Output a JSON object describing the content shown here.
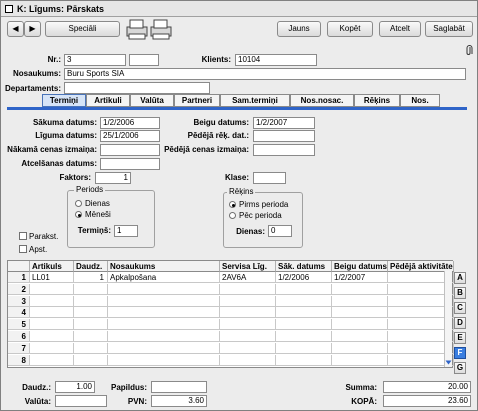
{
  "window": {
    "title": "K: Līgums: Pārskats"
  },
  "toolbar": {
    "nav_prev": "◀",
    "nav_next": "▶",
    "special": "Speciāli",
    "new": "Jauns",
    "copy": "Kopēt",
    "cancel": "Atcelt",
    "save": "Saglabāt"
  },
  "header": {
    "nr_label": "Nr.:",
    "nr_value": "3",
    "client_label": "Klients:",
    "client_value": "10104",
    "name_label": "Nosaukums:",
    "name_value": "Buru Sports SIA",
    "departments_label": "Departaments:",
    "departments_value": ""
  },
  "tabs": [
    {
      "label": "Termiņi",
      "active": true
    },
    {
      "label": "Artikuli",
      "active": false
    },
    {
      "label": "Valūta",
      "active": false
    },
    {
      "label": "Partneri",
      "active": false
    },
    {
      "label": "Sam.termiņi",
      "active": false
    },
    {
      "label": "Nos.nosac.",
      "active": false
    },
    {
      "label": "Rēķins",
      "active": false
    },
    {
      "label": "Nos.",
      "active": false
    }
  ],
  "terms": {
    "start_label": "Sākuma datums:",
    "start_value": "1/2/2006",
    "end_label": "Beigu datums:",
    "end_value": "1/2/2007",
    "contract_label": "Līguma datums:",
    "contract_value": "25/1/2006",
    "last_inv_label": "Pēdējā rēķ. dat.:",
    "last_inv_value": "",
    "next_price_label": "Nākamā cenas izmaiņa:",
    "next_price_value": "",
    "last_price_label": "Pēdējā cenas izmaiņa:",
    "last_price_value": "",
    "cancel_date_label": "Atcelšanas datums:",
    "cancel_date_value": "",
    "factor_label": "Faktors:",
    "factor_value": "1",
    "class_label": "Klase:",
    "class_value": "",
    "period_title": "Periods",
    "period_days": "Dienas",
    "period_months": "Mēneši",
    "period_selected": "Mēneši",
    "term_label": "Termiņš:",
    "term_value": "1",
    "invoice_title": "Rēķins",
    "invoice_before": "Pirms perioda",
    "invoice_after": "Pēc perioda",
    "invoice_selected": "Pirms perioda",
    "days_label": "Dienas:",
    "days_value": "0",
    "signed_label": "Parakst.",
    "approved_label": "Apst."
  },
  "grid": {
    "columns": [
      "",
      "Artikuls",
      "Daudz.",
      "Nosaukums",
      "Servisa Līg.",
      "Sāk. datums",
      "Beigu datums",
      "Pēdējā aktivitāte"
    ],
    "rows": [
      [
        "1",
        "LL01",
        "1",
        "Apkalpošana",
        "2AV6A",
        "1/2/2006",
        "1/2/2007",
        ""
      ],
      [
        "2",
        "",
        "",
        "",
        "",
        "",
        "",
        ""
      ],
      [
        "3",
        "",
        "",
        "",
        "",
        "",
        "",
        ""
      ],
      [
        "4",
        "",
        "",
        "",
        "",
        "",
        "",
        ""
      ],
      [
        "5",
        "",
        "",
        "",
        "",
        "",
        "",
        ""
      ],
      [
        "6",
        "",
        "",
        "",
        "",
        "",
        "",
        ""
      ],
      [
        "7",
        "",
        "",
        "",
        "",
        "",
        "",
        ""
      ],
      [
        "8",
        "",
        "",
        "",
        "",
        "",
        "",
        ""
      ]
    ],
    "side_buttons": [
      "A",
      "B",
      "C",
      "D",
      "E",
      "F",
      "G"
    ],
    "side_active": "F"
  },
  "footer": {
    "qty_label": "Daudz.:",
    "qty_value": "1.00",
    "extra_label": "Papildus:",
    "extra_value": "",
    "sum_label": "Summa:",
    "sum_value": "20.00",
    "currency_label": "Valūta:",
    "currency_value": "",
    "vat_label": "PVN:",
    "vat_value": "3.60",
    "total_label": "KOPĀ:",
    "total_value": "23.60"
  },
  "colors": {
    "tab_accent": "#2f64c8",
    "active_side_button": "#3a7ee0"
  },
  "icons": [
    "printer-icon",
    "attachment-icon"
  ]
}
